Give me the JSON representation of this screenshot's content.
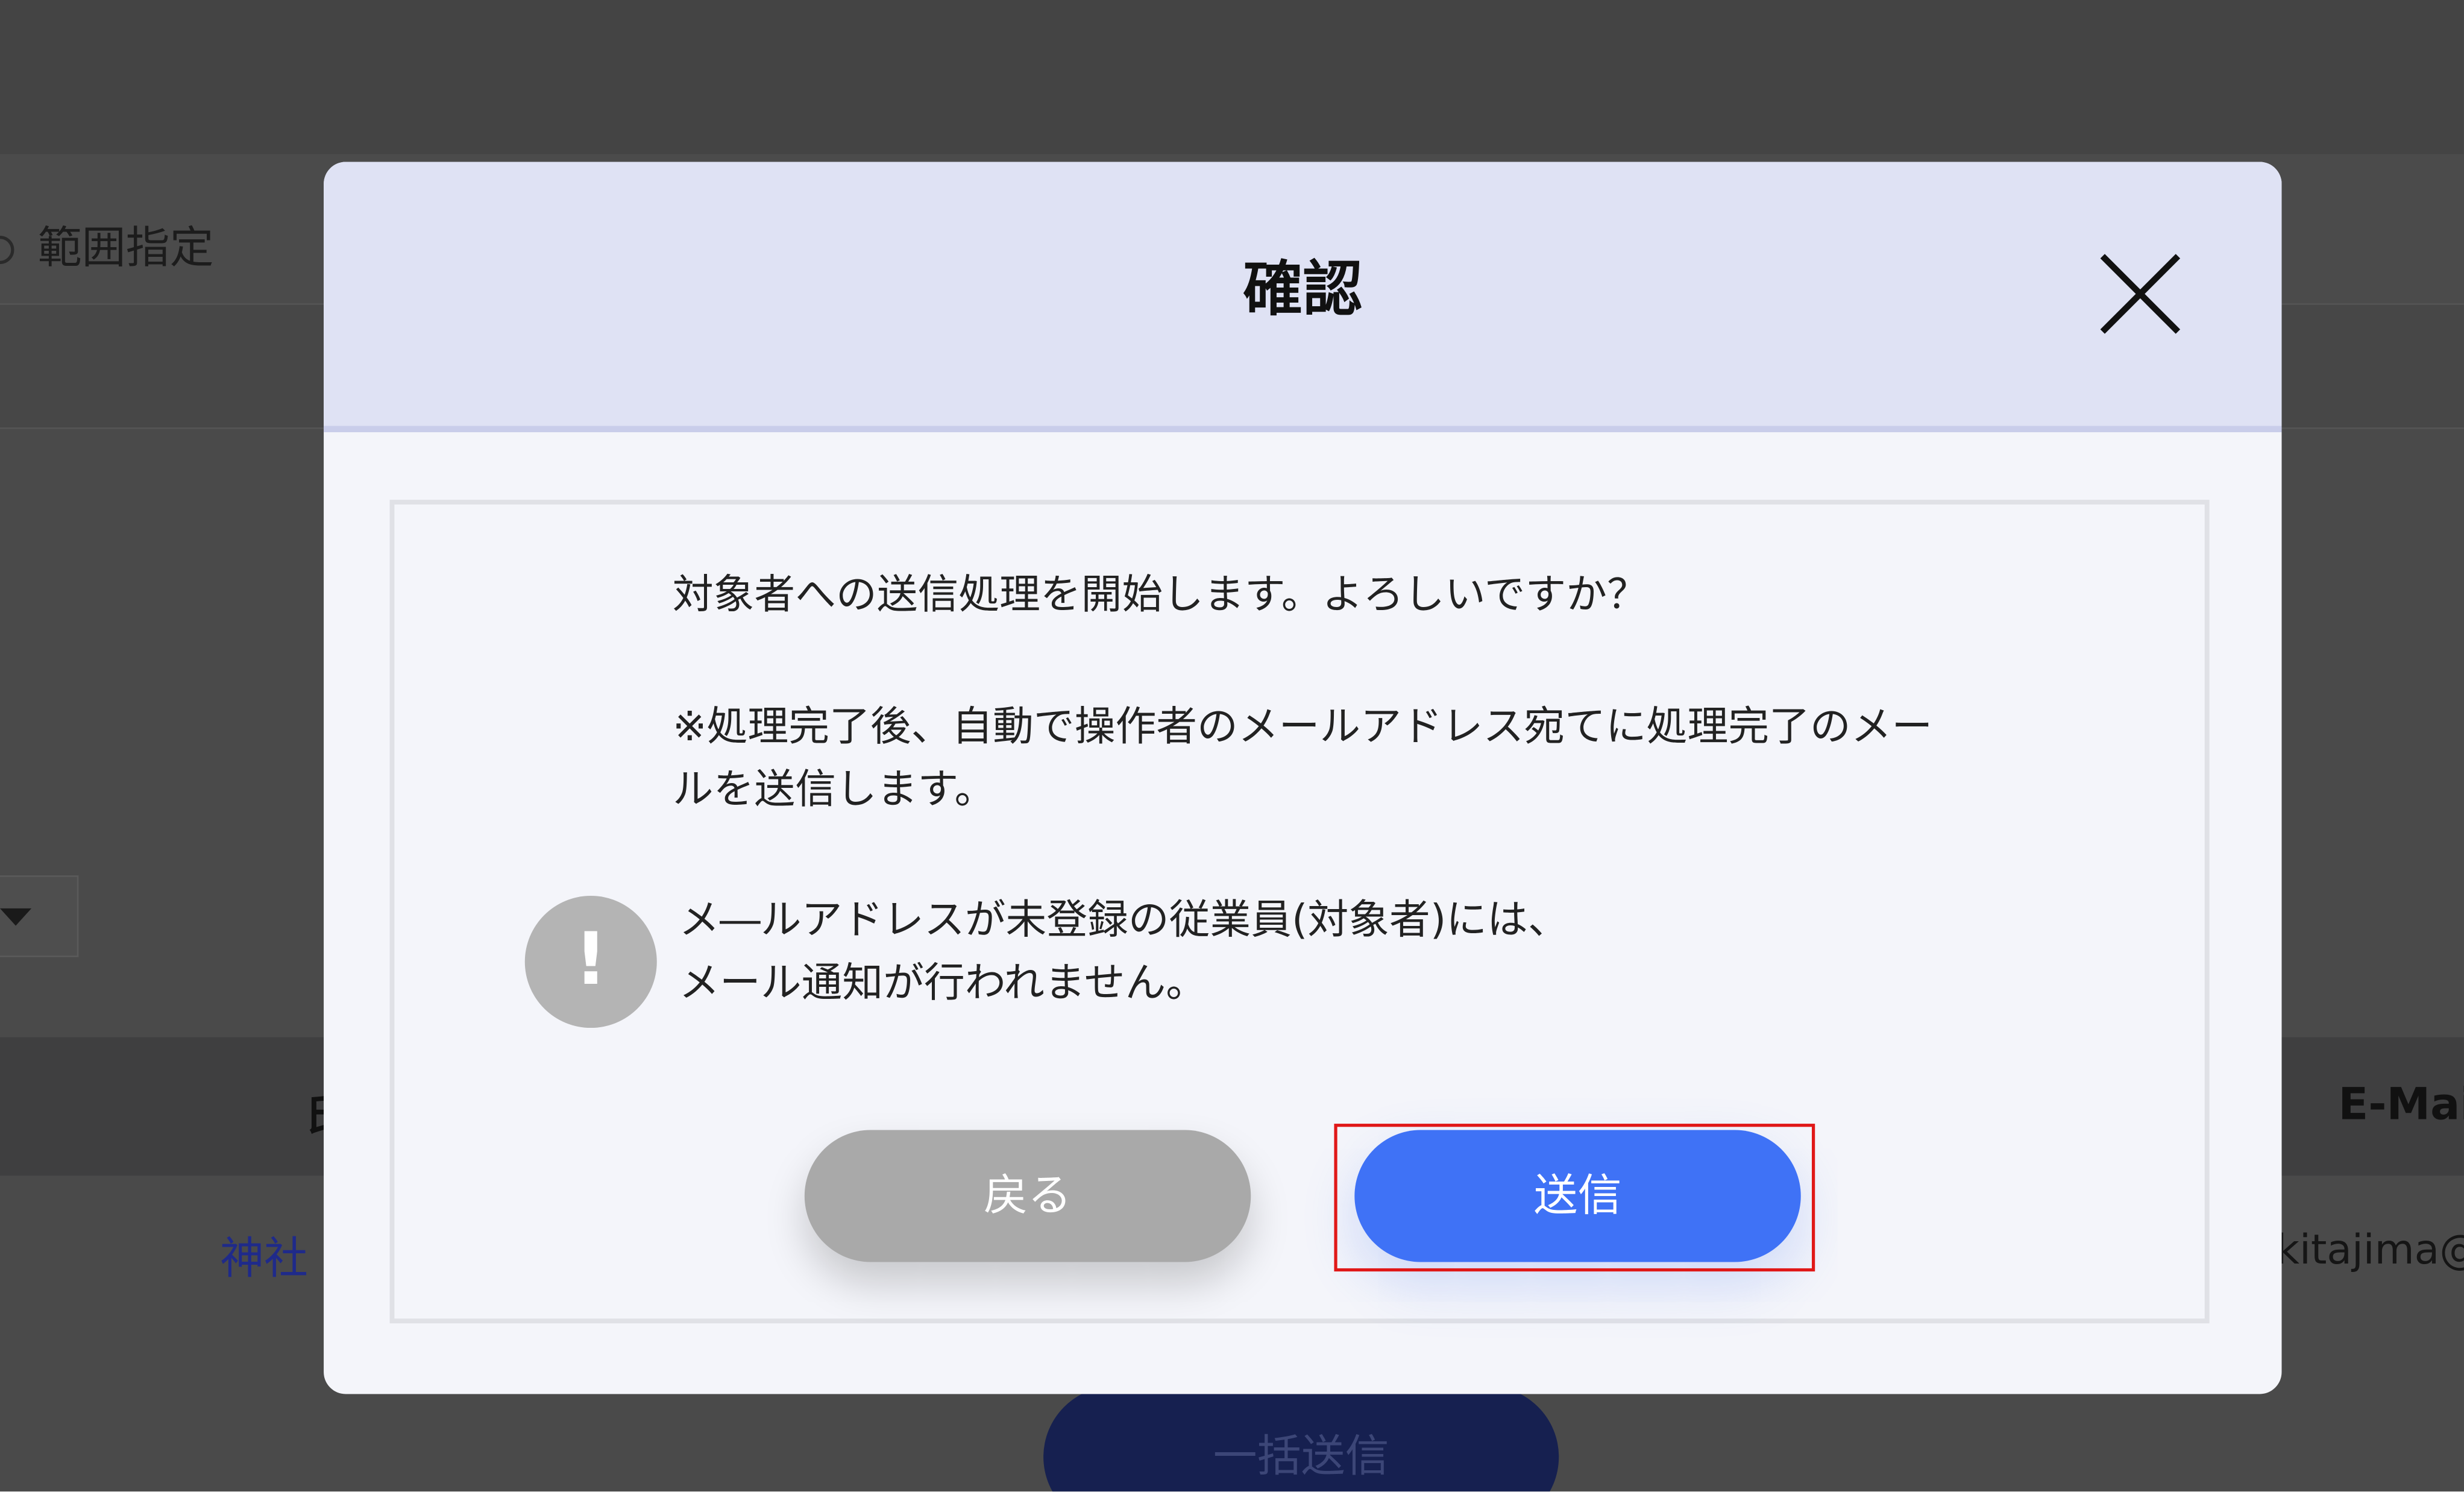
{
  "background": {
    "range_label": "範囲指定",
    "table_header_left": "氏",
    "table_header_email": "E-Mai",
    "row_name": "神社",
    "row_email": ".kitajima@",
    "bulk_send_label": "一括送信"
  },
  "modal": {
    "title": "確認",
    "message_line_1": "対象者への送信処理を開始します。よろしいですか？",
    "message_line_2": "※処理完了後、自動で操作者のメールアドレス宛てに処理完了のメー",
    "message_line_3": "ルを送信します。",
    "notice_symbol": "!",
    "notice_line_1": "メ―ルアドレスが未登録の従業員(対象者)には、",
    "notice_line_2": "メール通知が行われません。",
    "back_label": "戻る",
    "send_label": "送信"
  },
  "colors": {
    "overlay": "#464646",
    "header_bg": "#dfe2f4",
    "send_button": "#3f72f6",
    "back_button": "#a9a9a9",
    "highlight": "#e01818"
  },
  "icons": {
    "close": "close-icon",
    "notice": "exclamation-icon"
  }
}
